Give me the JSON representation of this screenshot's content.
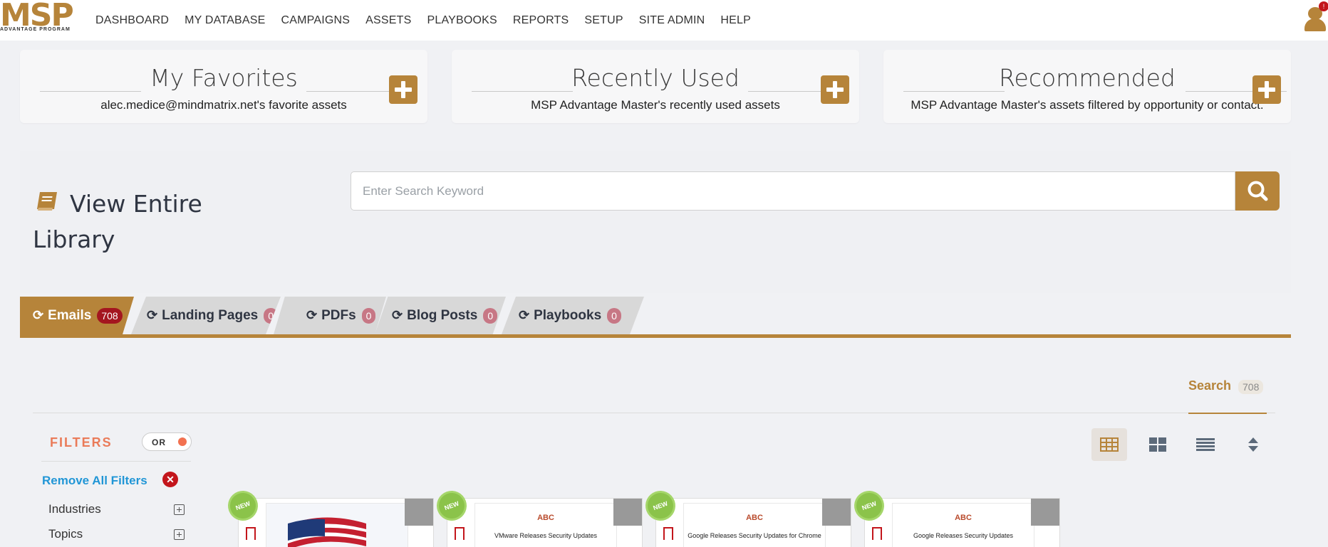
{
  "brand": {
    "name": "MSP",
    "tagline": "ADVANTAGE PROGRAM",
    "accent": "#b6843a"
  },
  "nav": [
    "DASHBOARD",
    "MY DATABASE",
    "CAMPAIGNS",
    "ASSETS",
    "PLAYBOOKS",
    "REPORTS",
    "SETUP",
    "SITE ADMIN",
    "HELP"
  ],
  "user": {
    "notification_badge": "!"
  },
  "cards": [
    {
      "title": "My Favorites",
      "description": "alec.medice@mindmatrix.net's favorite assets"
    },
    {
      "title": "Recently Used",
      "description": "MSP Advantage Master's recently used assets"
    },
    {
      "title": "Recommended",
      "description": "MSP Advantage Master's assets filtered by opportunity or contact."
    }
  ],
  "library": {
    "title": "View Entire Library",
    "search_placeholder": "Enter Search Keyword",
    "book_icon": "book-icon"
  },
  "tabs": [
    {
      "label": "Emails",
      "count": "708",
      "active": true
    },
    {
      "label": "Landing Pages",
      "count": "0",
      "active": false
    },
    {
      "label": "PDFs",
      "count": "0",
      "active": false
    },
    {
      "label": "Blog Posts",
      "count": "0",
      "active": false
    },
    {
      "label": "Playbooks",
      "count": "0",
      "active": false
    }
  ],
  "results": {
    "search_label": "Search",
    "search_count": "708"
  },
  "filters": {
    "label": "FILTERS",
    "toggle_label": "OR",
    "remove_all": "Remove All Filters",
    "facets": [
      "Industries",
      "Topics"
    ]
  },
  "assets": [
    {
      "new_label": "NEW",
      "logo": "",
      "title": "",
      "bar": "flag"
    },
    {
      "new_label": "NEW",
      "logo": "ABC",
      "title": "VMware Releases Security Updates",
      "bar": "dark"
    },
    {
      "new_label": "NEW",
      "logo": "ABC",
      "title": "Google Releases Security Updates for Chrome",
      "bar": "mint"
    },
    {
      "new_label": "NEW",
      "logo": "ABC",
      "title": "Google Releases Security Updates",
      "bar": "dark"
    }
  ]
}
